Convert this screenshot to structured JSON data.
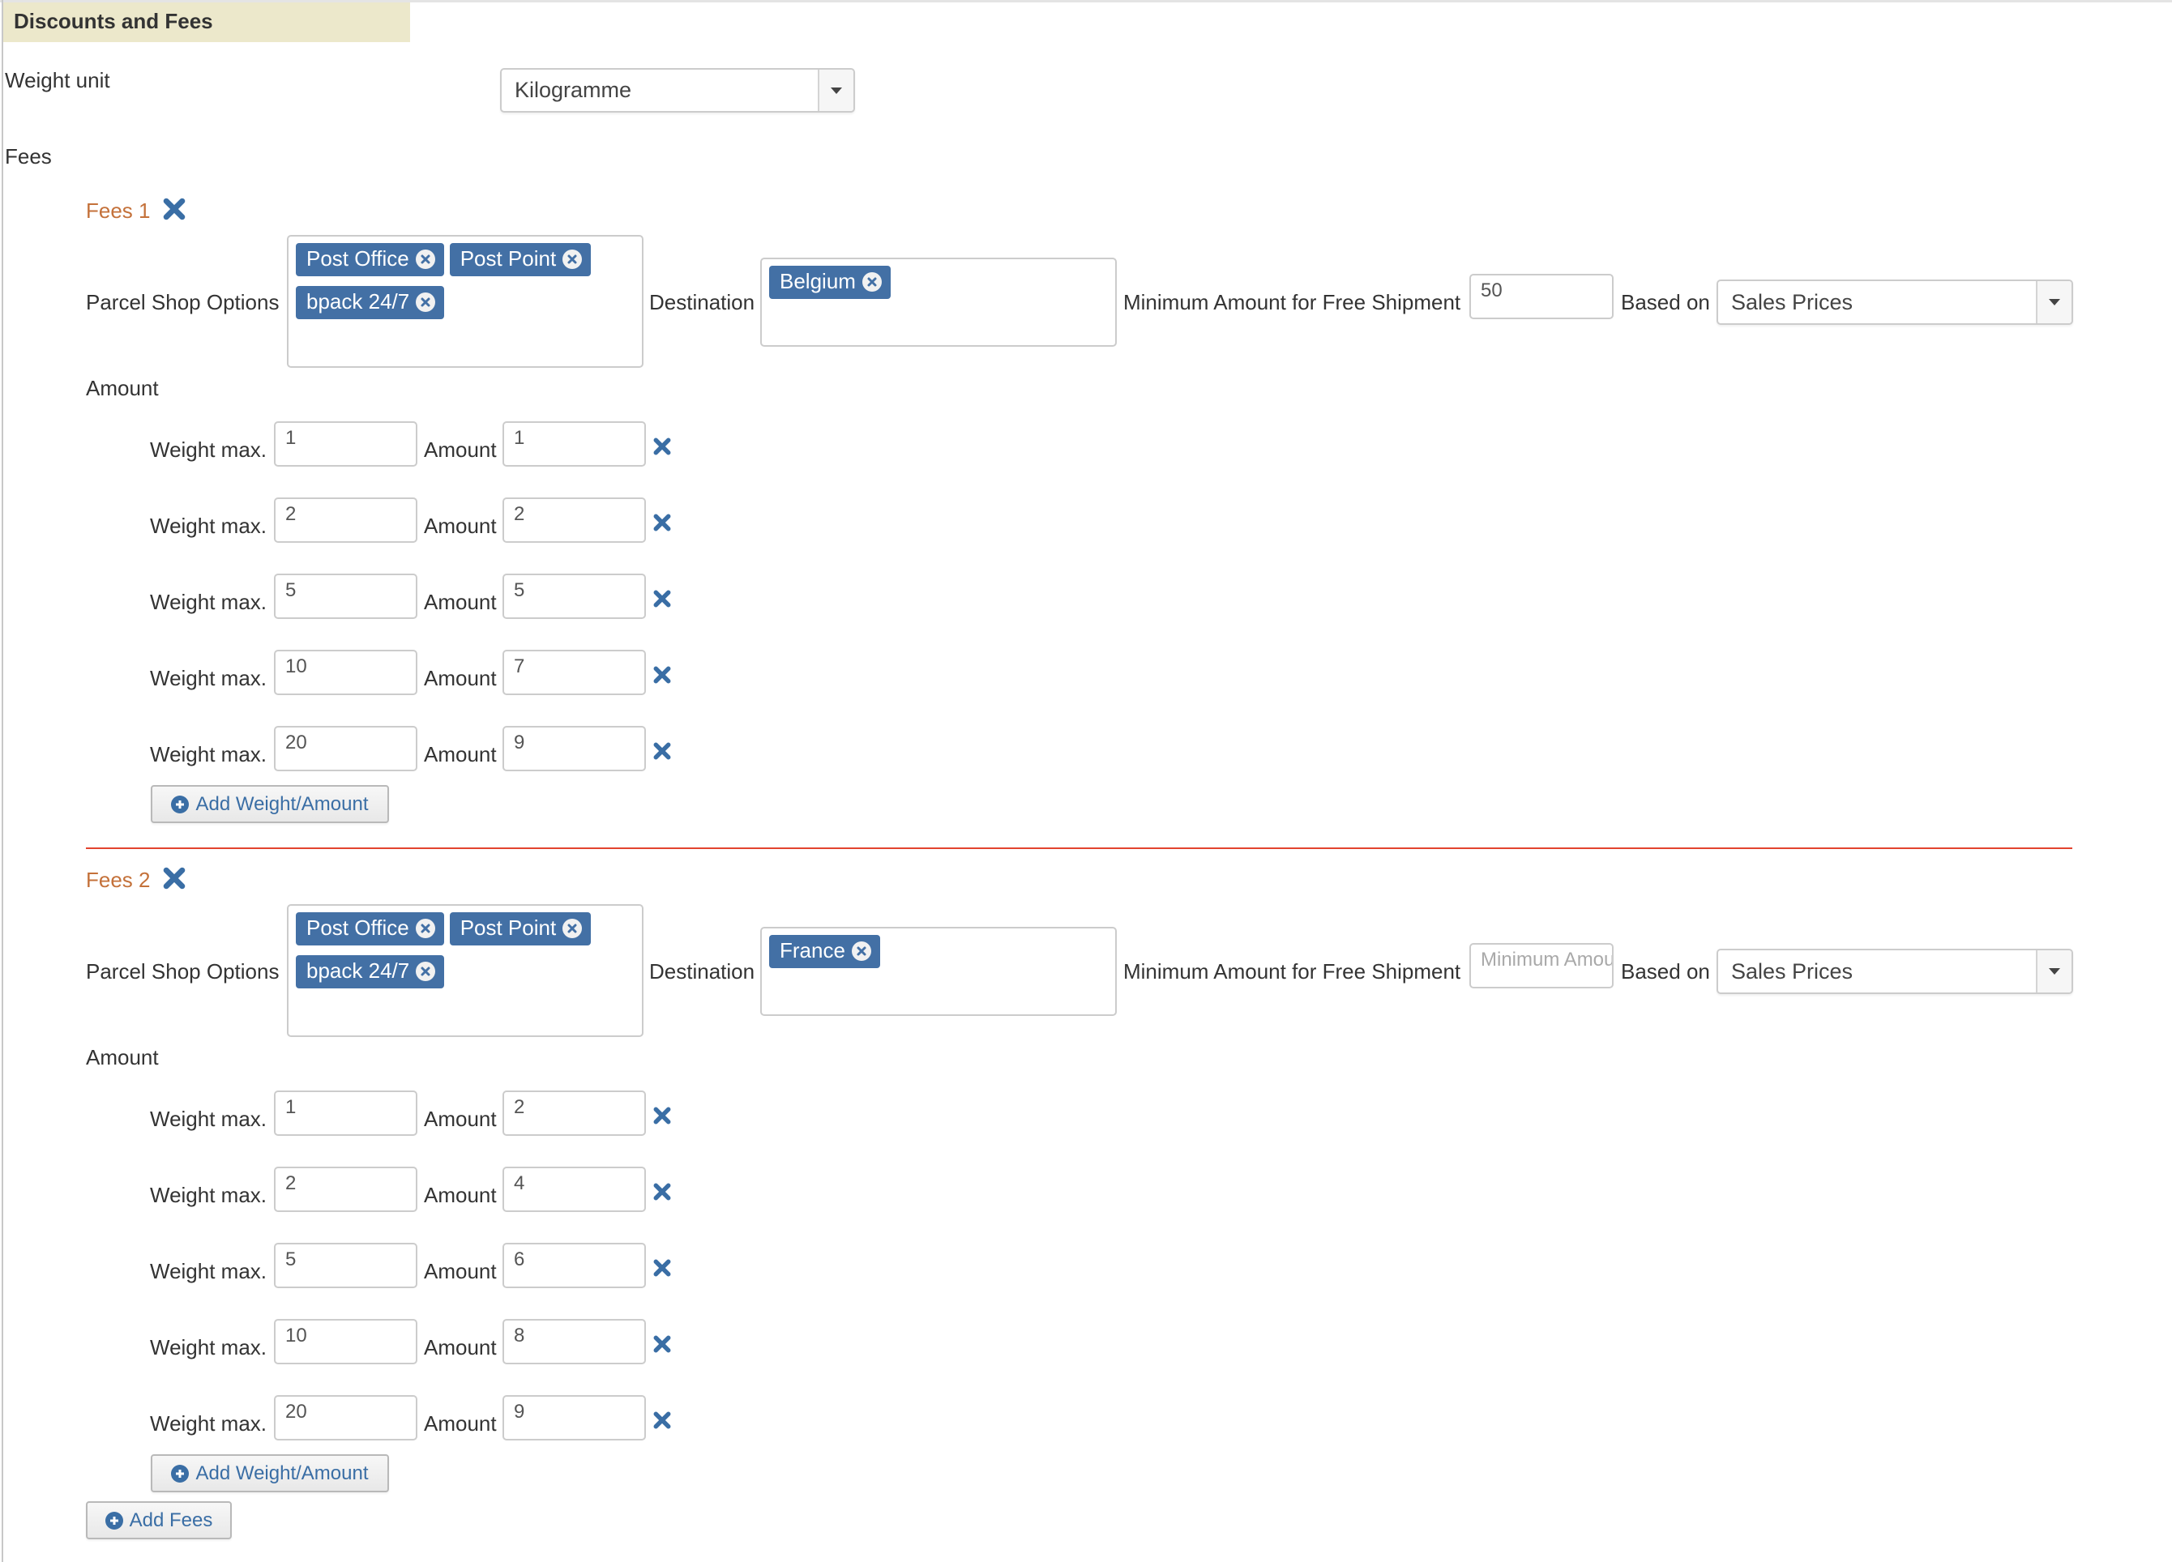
{
  "section_header": "Discounts and Fees",
  "weight_unit": {
    "label": "Weight unit",
    "value": "Kilogramme"
  },
  "fees_label": "Fees",
  "labels": {
    "parcel_shop_options": "Parcel Shop Options",
    "destination": "Destination",
    "minimum_amount": "Minimum Amount for Free Shipment",
    "based_on": "Based on",
    "amount_section": "Amount",
    "weight_max": "Weight max.",
    "amount": "Amount",
    "min_amount_placeholder": "Minimum Amount for Free Shipment"
  },
  "icons": {
    "remove_fees": "close-icon",
    "remove_tag": "circle-close-icon",
    "remove_row": "close-icon",
    "add": "circle-plus-icon",
    "dropdown": "caret-down-icon"
  },
  "colors": {
    "header_bg": "#ece8cb",
    "fees_title": "#c4713a",
    "tag_bg": "#4370a5",
    "accent_blue": "#3a6ea5",
    "separator": "#e2442f"
  },
  "fees": [
    {
      "title": "Fees 1",
      "parcel_shop_options": [
        "Post Office",
        "Post Point",
        "bpack 24/7"
      ],
      "destination": [
        "Belgium"
      ],
      "minimum_amount": "50",
      "based_on": "Sales Prices",
      "rows": [
        {
          "weight_max": "1",
          "amount": "1"
        },
        {
          "weight_max": "2",
          "amount": "2"
        },
        {
          "weight_max": "5",
          "amount": "5"
        },
        {
          "weight_max": "10",
          "amount": "7"
        },
        {
          "weight_max": "20",
          "amount": "9"
        }
      ],
      "add_button": "Add Weight/Amount"
    },
    {
      "title": "Fees 2",
      "parcel_shop_options": [
        "Post Office",
        "Post Point",
        "bpack 24/7"
      ],
      "destination": [
        "France"
      ],
      "minimum_amount": "",
      "based_on": "Sales Prices",
      "rows": [
        {
          "weight_max": "1",
          "amount": "2"
        },
        {
          "weight_max": "2",
          "amount": "4"
        },
        {
          "weight_max": "5",
          "amount": "6"
        },
        {
          "weight_max": "10",
          "amount": "8"
        },
        {
          "weight_max": "20",
          "amount": "9"
        }
      ],
      "add_button": "Add Weight/Amount"
    }
  ],
  "add_fees_button": "Add Fees"
}
